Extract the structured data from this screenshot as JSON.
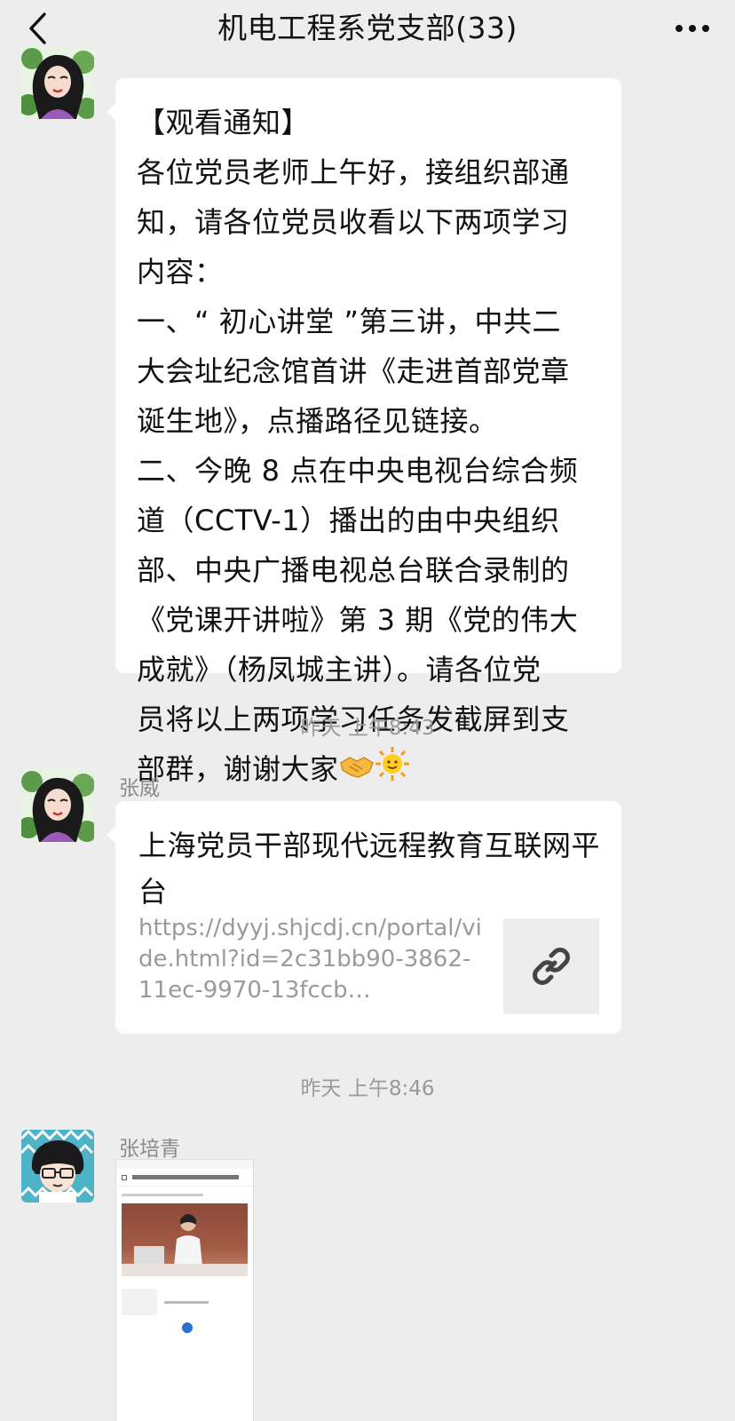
{
  "header": {
    "title": "机电工程系党支部(33)",
    "back_icon": "chevron-left-icon",
    "more_icon": "more-dots-icon"
  },
  "messages": [
    {
      "type": "text",
      "text": "【观看通知】\n各位党员老师上午好，接组织部通\n知，请各位党员收看以下两项学习\n内容：\n一、“ 初心讲堂 ”第三讲，中共二\n大会址纪念馆首讲《走进首部党章\n诞生地》，点播路径见链接。\n二、今晚 8 点在中央电视台综合频\n道（CCTV-1）播出的由中央组织\n部、中央广播电视总台联合录制的\n《党课开讲啦》第 3 期《党的伟大\n成就》（杨凤城主讲）。请各位党\n员将以上两项学习任务发截屏到支\n部群，谢谢大家",
      "emojis": [
        "handshake-emoji",
        "sun-emoji"
      ]
    },
    {
      "type": "time",
      "text": "昨天 上午8:43"
    },
    {
      "type": "link",
      "sender": "张威",
      "title": "上海党员干部现代远程教育互联网平台",
      "url": "https://dyyj.shjcdj.cn/portal/vide.html?id=2c31bb90-3862-11ec-9970-13fccb…",
      "thumb_icon": "link-chain-icon"
    },
    {
      "type": "time",
      "text": "昨天 上午8:46"
    },
    {
      "type": "image",
      "sender": "张培青"
    }
  ]
}
